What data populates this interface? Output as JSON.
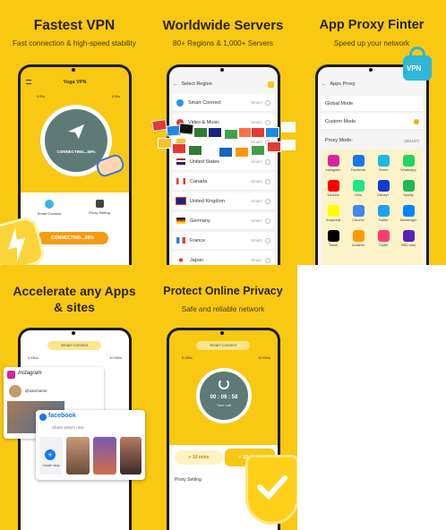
{
  "p1": {
    "title": "Fastest VPN",
    "subtitle": "Fast connection & high-speed stability",
    "app_title": "Yoga VPN",
    "status": "CONNECTING...58%",
    "btn": "CONNECTING...58%",
    "smart": "Smart Connect",
    "proxy": "Proxy Setting",
    "speed1": "0 B/s",
    "speed2": "0 B/s"
  },
  "p2": {
    "title": "Worldwide Servers",
    "subtitle": "80+ Regions & 1,000+ Servers",
    "header": "Select Region",
    "smart_label": "Smart",
    "rows": [
      {
        "name": "Smart Connect",
        "color": "#2196f3"
      },
      {
        "name": "Video & Music",
        "color": "#e53935"
      },
      {
        "name": "",
        "color": "#fbc02d"
      },
      {
        "name": "United States",
        "color": "#3f51b5"
      },
      {
        "name": "Canada",
        "color": "#e53935"
      },
      {
        "name": "United Kingdom",
        "color": "#1a237e"
      },
      {
        "name": "Germany",
        "color": "#212121"
      },
      {
        "name": "France",
        "color": "#1e88e5"
      },
      {
        "name": "Japan",
        "color": "#ffffff"
      }
    ]
  },
  "p3": {
    "title": "App Proxy Finter",
    "subtitle": "Speed up your network",
    "header": "Apps Proxy",
    "global": "Global Mode",
    "custom": "Custom Mode",
    "proxy_mode": "Proxy Mode:",
    "count": "(86/137)",
    "badge": "VPN",
    "apps": [
      {
        "name": "Instagram",
        "color": "#d6249f"
      },
      {
        "name": "Facebook",
        "color": "#1877f2"
      },
      {
        "name": "Vimeo",
        "color": "#1ab7ea"
      },
      {
        "name": "WhatsApp",
        "color": "#25d366"
      },
      {
        "name": "Youtube",
        "color": "#ff0000"
      },
      {
        "name": "Hulu",
        "color": "#1ce783"
      },
      {
        "name": "Disney+",
        "color": "#113ccf"
      },
      {
        "name": "Spotify",
        "color": "#1db954"
      },
      {
        "name": "Snapchat",
        "color": "#fffc00"
      },
      {
        "name": "Chrome",
        "color": "#4285f4"
      },
      {
        "name": "Twitter",
        "color": "#1da1f2"
      },
      {
        "name": "Messenger",
        "color": "#0084ff"
      },
      {
        "name": "Tiktok",
        "color": "#000000"
      },
      {
        "name": "Amazon",
        "color": "#ff9900"
      },
      {
        "name": "Tinder",
        "color": "#fe3c72"
      },
      {
        "name": "HBO max",
        "color": "#5822b4"
      }
    ]
  },
  "p4": {
    "title": "Accelerate any Apps & sites",
    "smart": "Smart Connect",
    "insta": "Instagram",
    "username": "@username",
    "fb": "facebook",
    "whats": "Share what's new",
    "your_story": "Create story",
    "speed1": "0 KB/s",
    "speed2": "10 KB/s"
  },
  "p5": {
    "title": "Protect Online Privacy",
    "subtitle": "Safe and reliable network",
    "smart": "Smart Connect",
    "timer": "00 : 09 : 58",
    "timer_label": "Time Left",
    "add10": "+ 10 mins",
    "add15": "+ 15 mins",
    "proxy": "Proxy Setting",
    "speed1": "0 KB/s",
    "speed2": "10 KB/s"
  }
}
